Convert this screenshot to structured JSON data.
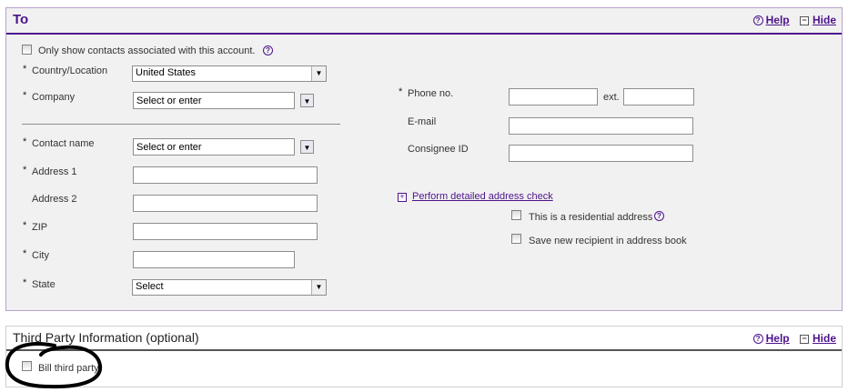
{
  "to_panel": {
    "title": "To",
    "help": "Help",
    "hide": "Hide",
    "only_show_contacts": "Only show contacts associated with this account.",
    "country_label": "Country/Location",
    "country_value": "United States",
    "company_label": "Company",
    "company_value": "Select or enter",
    "contact_label": "Contact name",
    "contact_value": "Select or enter",
    "address1_label": "Address 1",
    "address2_label": "Address 2",
    "zip_label": "ZIP",
    "city_label": "City",
    "state_label": "State",
    "state_value": "Select",
    "phone_label": "Phone no.",
    "ext_label": "ext.",
    "email_label": "E-mail",
    "consignee_label": "Consignee ID",
    "address_check": "Perform detailed address check",
    "residential": "This is a residential address",
    "save_recipient": "Save new recipient in address book",
    "required_mark": "*"
  },
  "third_party": {
    "title": "Third Party Information (optional)",
    "help": "Help",
    "hide": "Hide",
    "bill_third_party": "Bill third party"
  },
  "colors": {
    "accent": "#4d148c",
    "panel_bg": "#f1f1f1",
    "annotation": "#000000"
  },
  "icons": [
    "help-icon",
    "hide-icon",
    "plus-icon",
    "dropdown-arrow-icon"
  ]
}
